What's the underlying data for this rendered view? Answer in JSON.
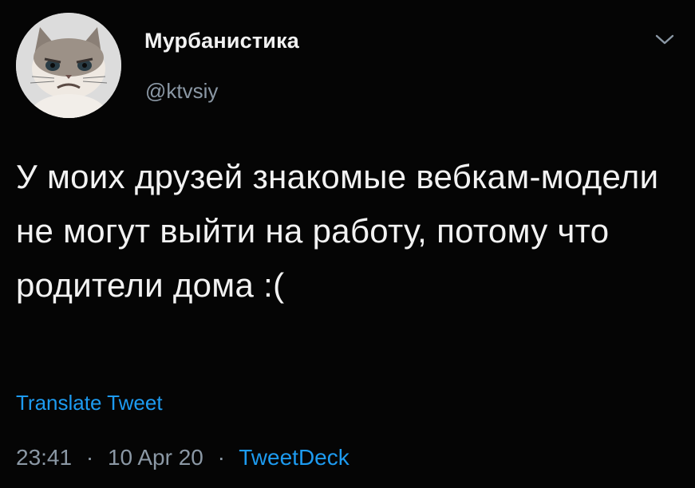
{
  "user": {
    "display_name": "Мурбанистика",
    "handle": "@ktvsiy"
  },
  "tweet": {
    "text": "У моих друзей знакомые вебкам-модели не могут выйти на работу, потому что родители дома :(",
    "translate_label": "Translate Tweet",
    "time": "23:41",
    "date": "10 Apr 20",
    "separator": "·",
    "source": "TweetDeck"
  },
  "icons": {
    "menu": "chevron-down-icon",
    "avatar": "grumpy-cat-avatar"
  },
  "colors": {
    "background": "#050505",
    "text": "#f2f2f2",
    "muted": "#8b98a5",
    "link": "#1d9bf0"
  }
}
